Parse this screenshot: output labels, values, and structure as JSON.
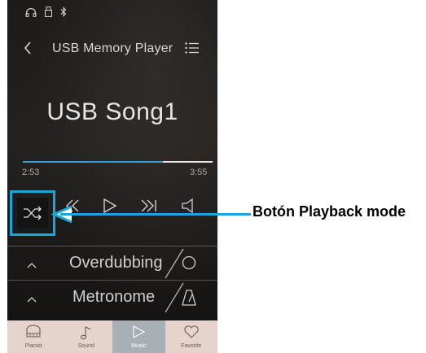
{
  "status_bar": {
    "icons": [
      "headphones-icon",
      "usb-icon",
      "bluetooth-icon"
    ]
  },
  "header": {
    "title": "USB Memory Player",
    "back_icon": "chevron-left-icon",
    "menu_icon": "list-menu-icon"
  },
  "player": {
    "song_title": "USB Song1",
    "elapsed": "2:53",
    "total": "3:55",
    "progress": 0.74
  },
  "controls": {
    "playback_mode_icon": "shuffle-icon",
    "rewind_icon": "rewind-icon",
    "play_icon": "play-icon",
    "forward_icon": "fast-forward-icon",
    "volume_icon": "speaker-icon"
  },
  "options": [
    {
      "label": "Overdubbing",
      "icon": "record-circle-icon"
    },
    {
      "label": "Metronome",
      "icon": "metronome-icon"
    }
  ],
  "tabs": [
    {
      "label": "Pianist",
      "icon": "piano-icon",
      "active": false
    },
    {
      "label": "Sound",
      "icon": "music-note-icon",
      "active": false
    },
    {
      "label": "Music",
      "icon": "play-outline-icon",
      "active": true
    },
    {
      "label": "Favorite",
      "icon": "heart-icon",
      "active": false
    }
  ],
  "callout": {
    "text": "Botón Playback mode"
  },
  "colors": {
    "accent": "#1aa5df",
    "progress": "#3aa0d8",
    "tab_bg": "#e6d3cb",
    "tab_active_bg": "#a8b0b6"
  }
}
